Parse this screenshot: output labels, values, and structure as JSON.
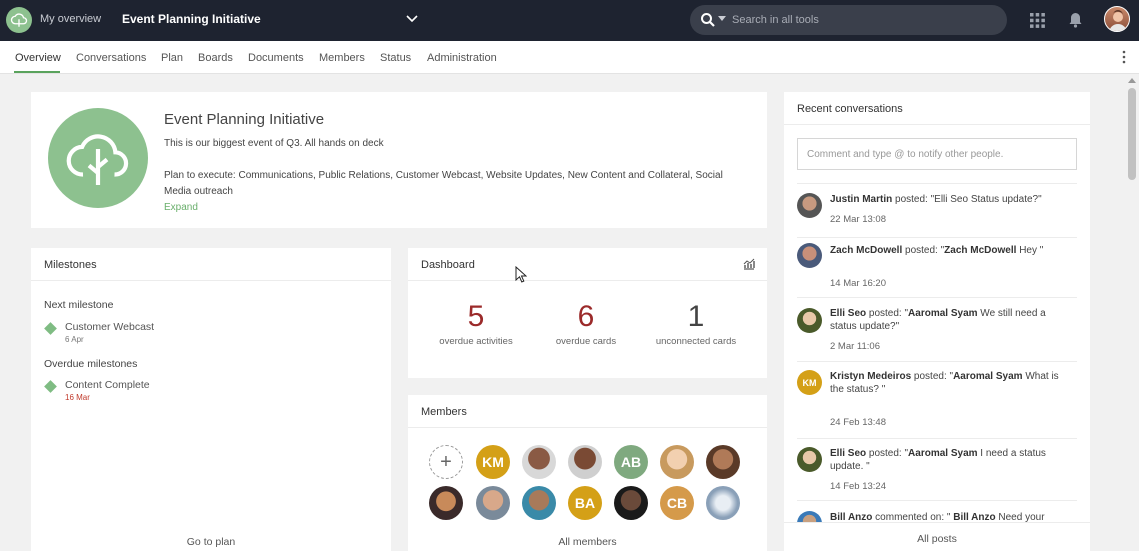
{
  "topbar": {
    "my_overview": "My overview",
    "project_title": "Event Planning Initiative",
    "search_placeholder": "Search in all tools"
  },
  "nav": {
    "tabs": [
      "Overview",
      "Conversations",
      "Plan",
      "Boards",
      "Documents",
      "Members",
      "Status",
      "Administration"
    ],
    "active_tab": "Overview"
  },
  "project": {
    "name": "Event Planning Initiative",
    "description": "This is our biggest event of Q3. All hands on deck",
    "plan": "Plan to execute: Communications, Public Relations, Customer Webcast, Website Updates, New Content and Collateral, Social Media outreach",
    "expand_label": "Expand"
  },
  "milestones": {
    "title": "Milestones",
    "next_label": "Next milestone",
    "next": {
      "name": "Customer Webcast",
      "date": "6 Apr"
    },
    "overdue_label": "Overdue milestones",
    "overdue": {
      "name": "Content Complete",
      "date": "16 Mar"
    },
    "go_to_plan": "Go to plan"
  },
  "dashboard": {
    "title": "Dashboard",
    "stats": [
      {
        "value": "5",
        "label": "overdue activities"
      },
      {
        "value": "6",
        "label": "overdue cards"
      },
      {
        "value": "1",
        "label": "unconnected cards"
      }
    ]
  },
  "members": {
    "title": "Members",
    "initials": [
      "KM",
      "AB",
      "BA",
      "CB"
    ],
    "all_members": "All members",
    "colors": {
      "KM": "#d4a017",
      "AB": "#7fa97f",
      "BA": "#d4a017",
      "CB": "#d59a4a"
    }
  },
  "recent": {
    "title": "Recent conversations",
    "comment_placeholder": "Comment and type @ to notify other people.",
    "items": [
      {
        "author": "Justin Martin",
        "action": " posted: \"Elli Seo Status update?\"",
        "time": "22 Mar 13:08"
      },
      {
        "author": "Zach McDowell",
        "action": " posted: \"",
        "mention": "Zach McDowell",
        "rest": " Hey \"",
        "time": "14 Mar 16:20"
      },
      {
        "author": "Elli Seo",
        "action": " posted: \"",
        "mention": "Aaromal Syam",
        "rest": " We still need a status update?\"",
        "time": "2 Mar 11:06"
      },
      {
        "author": "Kristyn Medeiros",
        "action": " posted: \"",
        "mention": "Aaromal Syam",
        "rest": " What is the status? \"",
        "time": "24 Feb 13:48",
        "initials": "KM"
      },
      {
        "author": "Elli Seo",
        "action": " posted: \"",
        "mention": "Aaromal Syam",
        "rest": " I need a status update. \"",
        "time": "14 Feb 13:24"
      },
      {
        "author": "Bill Anzo",
        "action": " commented on: \" ",
        "mention": "Bill Anzo",
        "rest": " Need your"
      }
    ],
    "all_posts": "All posts"
  }
}
